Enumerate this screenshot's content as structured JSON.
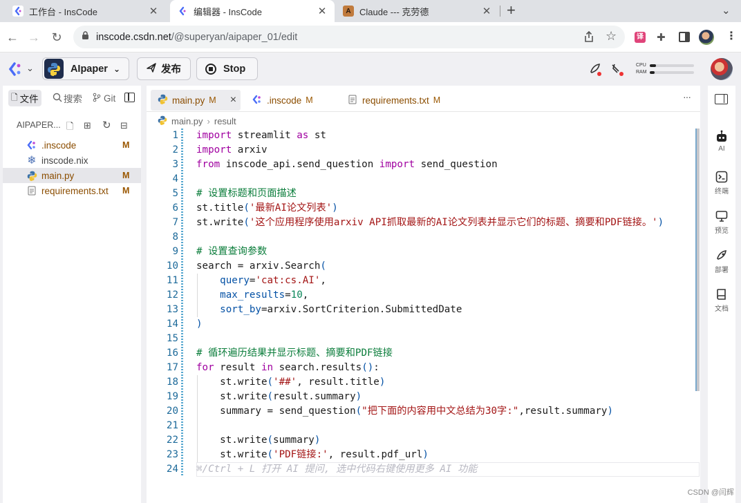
{
  "browser": {
    "tabs": [
      {
        "title": "工作台 - InsCode",
        "favicon": "inscode-icon"
      },
      {
        "title": "编辑器 - InsCode",
        "favicon": "inscode-icon",
        "active": true
      },
      {
        "title": "Claude --- 克劳德",
        "favicon": "claude-icon"
      }
    ],
    "new_tab": "+",
    "url": {
      "host": "inscode.csdn.net",
      "path": "/@superyan/aipaper_01/edit"
    }
  },
  "header": {
    "project_name": "AIpaper",
    "publish_label": "发布",
    "stop_label": "Stop",
    "cpu_label": "CPU",
    "ram_label": "RAM",
    "cpu_usage": 0.14,
    "ram_usage": 0.11
  },
  "left_panel": {
    "tabs": [
      "文件",
      "搜索",
      "Git"
    ],
    "root": "AIPAPER...",
    "files": [
      {
        "name": ".inscode",
        "status": "M",
        "icon": "inscode-icon"
      },
      {
        "name": "inscode.nix",
        "status": "",
        "icon": "nix-icon"
      },
      {
        "name": "main.py",
        "status": "M",
        "icon": "python-icon",
        "selected": true
      },
      {
        "name": "requirements.txt",
        "status": "M",
        "icon": "text-file-icon"
      }
    ]
  },
  "editor": {
    "tabs": [
      {
        "name": "main.py",
        "status": "M",
        "close": "×"
      },
      {
        "name": ".inscode",
        "status": "M"
      },
      {
        "name": "requirements.txt",
        "status": "M"
      }
    ],
    "more": "···",
    "breadcrumb": [
      "main.py",
      "result"
    ],
    "code_lines": [
      {
        "n": "1",
        "html": "<span class='kw'>import</span> streamlit <span class='kw'>as</span> st"
      },
      {
        "n": "2",
        "html": "<span class='kw'>import</span> arxiv"
      },
      {
        "n": "3",
        "html": "<span class='kw'>from</span> inscode_api.send_question <span class='kw'>import</span> send_question"
      },
      {
        "n": "4",
        "html": ""
      },
      {
        "n": "5",
        "html": "<span class='cm'># 设置标题和页面描述</span>"
      },
      {
        "n": "6",
        "html": "st.title<span class='bl'>(</span><span class='st'>'最新AI论文列表'</span><span class='bl'>)</span>"
      },
      {
        "n": "7",
        "html": "st.write<span class='bl'>(</span><span class='st'>'这个应用程序使用arxiv API抓取最新的AI论文列表并显示它们的标题、摘要和PDF链接。'</span><span class='bl'>)</span>"
      },
      {
        "n": "8",
        "html": ""
      },
      {
        "n": "9",
        "html": "<span class='cm'># 设置查询参数</span>"
      },
      {
        "n": "10",
        "html": "search = arxiv.Search<span class='bl'>(</span>"
      },
      {
        "n": "11",
        "html": "    <span class='bl'>query</span>=<span class='st'>'cat:cs.AI'</span>,"
      },
      {
        "n": "12",
        "html": "    <span class='bl'>max_results</span>=<span class='nu'>10</span>,"
      },
      {
        "n": "13",
        "html": "    <span class='bl'>sort_by</span>=arxiv.SortCriterion.SubmittedDate"
      },
      {
        "n": "14",
        "html": "<span class='bl'>)</span>"
      },
      {
        "n": "15",
        "html": ""
      },
      {
        "n": "16",
        "html": "<span class='cm'># 循环遍历结果并显示标题、摘要和PDF链接</span>"
      },
      {
        "n": "17",
        "html": "<span class='kw'>for</span> result <span class='kw'>in</span> search.results<span class='bl'>()</span>:"
      },
      {
        "n": "18",
        "html": "    st.write<span class='bl'>(</span><span class='st'>'##'</span>, result.title<span class='bl'>)</span>"
      },
      {
        "n": "19",
        "html": "    st.write<span class='bl'>(</span>result.summary<span class='bl'>)</span>"
      },
      {
        "n": "20",
        "html": "    summary = send_question<span class='bl'>(</span><span class='st'>\"把下面的内容用中文总结为30字:\"</span>,result.summary<span class='bl'>)</span>"
      },
      {
        "n": "21",
        "html": ""
      },
      {
        "n": "22",
        "html": "    st.write<span class='bl'>(</span>summary<span class='bl'>)</span>"
      },
      {
        "n": "23",
        "html": "    st.write<span class='bl'>(</span><span class='st'>'PDF链接:'</span>, result.pdf_url<span class='bl'>)</span>"
      },
      {
        "n": "24",
        "html": "<span class='ai'>⌘/Ctrl + L 打开 AI 提问, 选中代码右键使用更多 AI 功能</span>"
      }
    ]
  },
  "right_sidebar": [
    {
      "label": "AI",
      "icon": "robot-icon"
    },
    {
      "label": "终端",
      "icon": "terminal-icon"
    },
    {
      "label": "预览",
      "icon": "monitor-icon"
    },
    {
      "label": "部署",
      "icon": "rocket-icon"
    },
    {
      "label": "文档",
      "icon": "book-icon"
    }
  ],
  "watermark": "CSDN @闫辉"
}
